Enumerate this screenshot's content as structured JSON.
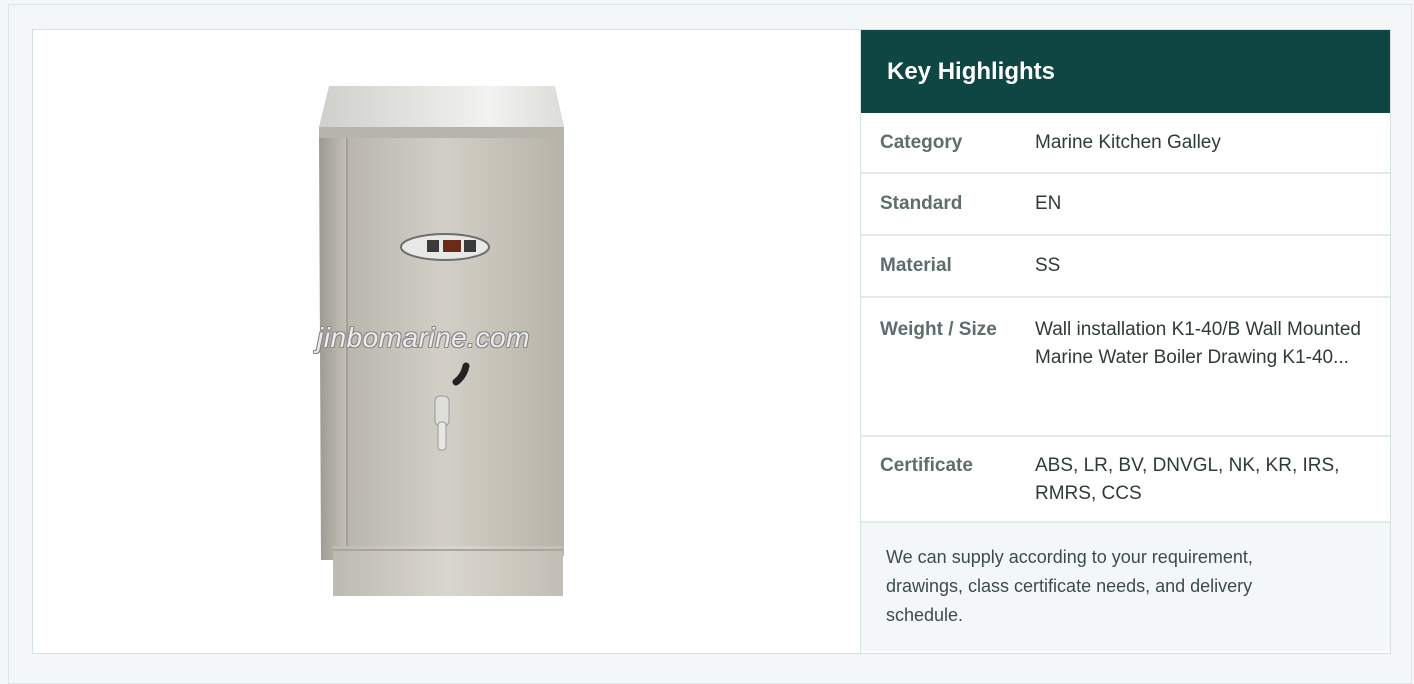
{
  "product": {
    "image_alt": "Wall Mounted Marine Water Boiler",
    "watermark": "jinbomarine.com"
  },
  "highlights": {
    "title": "Key Highlights",
    "rows": [
      {
        "label": "Category",
        "value": "Marine Kitchen Galley"
      },
      {
        "label": "Standard",
        "value": "EN"
      },
      {
        "label": "Material",
        "value": "SS"
      },
      {
        "label": "Weight / Size",
        "value": "Wall installation K1-40/B Wall Mounted Marine Water Boiler Drawing K1-40..."
      },
      {
        "label": "Certificate",
        "value": "ABS, LR, BV, DNVGL, NK, KR, IRS, RMRS, CCS"
      }
    ],
    "note": "We can supply according to your requirement, drawings, class certificate needs, and delivery schedule."
  }
}
